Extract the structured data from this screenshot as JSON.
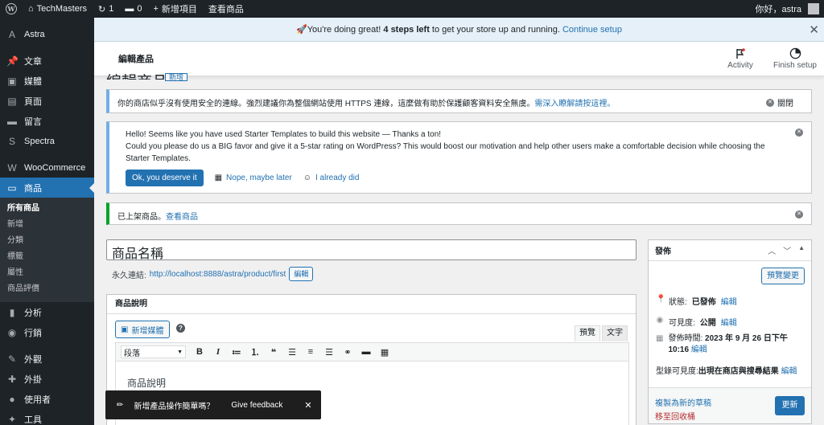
{
  "adminbar": {
    "site_name": "TechMasters",
    "updates_count": "1",
    "comments_count": "0",
    "new_item": "新增項目",
    "view_product": "查看商品",
    "greeting": "你好，astra"
  },
  "sidebar": {
    "items": [
      {
        "label": "Astra",
        "icon": "A"
      },
      {
        "label": "文章",
        "icon": "📌"
      },
      {
        "label": "媒體",
        "icon": "▣"
      },
      {
        "label": "頁面",
        "icon": "▤"
      },
      {
        "label": "留言",
        "icon": "▬"
      },
      {
        "label": "Spectra",
        "icon": "S"
      },
      {
        "label": "WooCommerce",
        "icon": "W"
      },
      {
        "label": "商品",
        "icon": "▭"
      }
    ],
    "submenu": [
      "所有商品",
      "新增",
      "分類",
      "標籤",
      "屬性",
      "商品評價"
    ],
    "bottom_items": [
      {
        "label": "分析",
        "icon": "▮"
      },
      {
        "label": "行銷",
        "icon": "◉"
      },
      {
        "label": "外觀",
        "icon": "✎"
      },
      {
        "label": "外掛",
        "icon": "✚"
      },
      {
        "label": "使用者",
        "icon": "●"
      },
      {
        "label": "工具",
        "icon": "✦"
      }
    ]
  },
  "setup_banner": {
    "emoji": "🚀",
    "text_before": "You're doing great! ",
    "steps_bold": "4 steps left",
    "text_after": " to get your store up and running. ",
    "link": "Continue setup"
  },
  "header": {
    "title": "編輯產品",
    "activity": "Activity",
    "finish_setup": "Finish setup"
  },
  "page": {
    "ghost_title": "編輯商品",
    "ghost_button": "新增"
  },
  "notices": {
    "https_text": "你的商店似乎沒有使用安全的連線。強烈建議你為整個網站使用 HTTPS 連線，這麼做有助於保護顧客資料安全無虞。",
    "https_link": "需深入瞭解請按這裡。",
    "https_dismiss": "關閉",
    "starter_line1": "Hello! Seems like you have used Starter Templates to build this website — Thanks a ton!",
    "starter_line2": "Could you please do us a BIG favor and give it a 5-star rating on WordPress? This would boost our motivation and help other users make a comfortable decision while choosing the Starter Templates.",
    "starter_btn_yes": "Ok, you deserve it",
    "starter_btn_later": "Nope, maybe later",
    "starter_btn_done": "I already did",
    "published_text": "已上架商品。",
    "published_link": "查看商品"
  },
  "editor": {
    "title_value": "商品名稱",
    "permalink_label": "永久連結:",
    "permalink_url": "http://localhost:8888/astra/product/first",
    "permalink_edit": "編輯",
    "box_title": "商品說明",
    "add_media": "新增媒體",
    "tab_visual": "預覽",
    "tab_text": "文字",
    "format_select": "段落",
    "content": "商品說明"
  },
  "publish": {
    "title": "發佈",
    "preview_changes": "預覽變更",
    "status_label": "狀態:",
    "status_value": "已發佈",
    "visibility_label": "可見度:",
    "visibility_value": "公開",
    "published_label": "發佈時間:",
    "published_value": "2023 年 9 月 26 日下午 10:16",
    "edit": "編輯",
    "catalog_label": "型錄可見度:",
    "catalog_value": "出現在商店與搜尋結果",
    "copy_draft": "複製為新的草稿",
    "trash": "移至回收桶",
    "update": "更新"
  },
  "toast": {
    "question": "新增產品操作簡單嗎？",
    "feedback": "Give feedback"
  },
  "colors": {
    "accent": "#2271b1",
    "admin_dark": "#1d2327",
    "trash_red": "#b32d2e",
    "success_green": "#00a32a"
  }
}
